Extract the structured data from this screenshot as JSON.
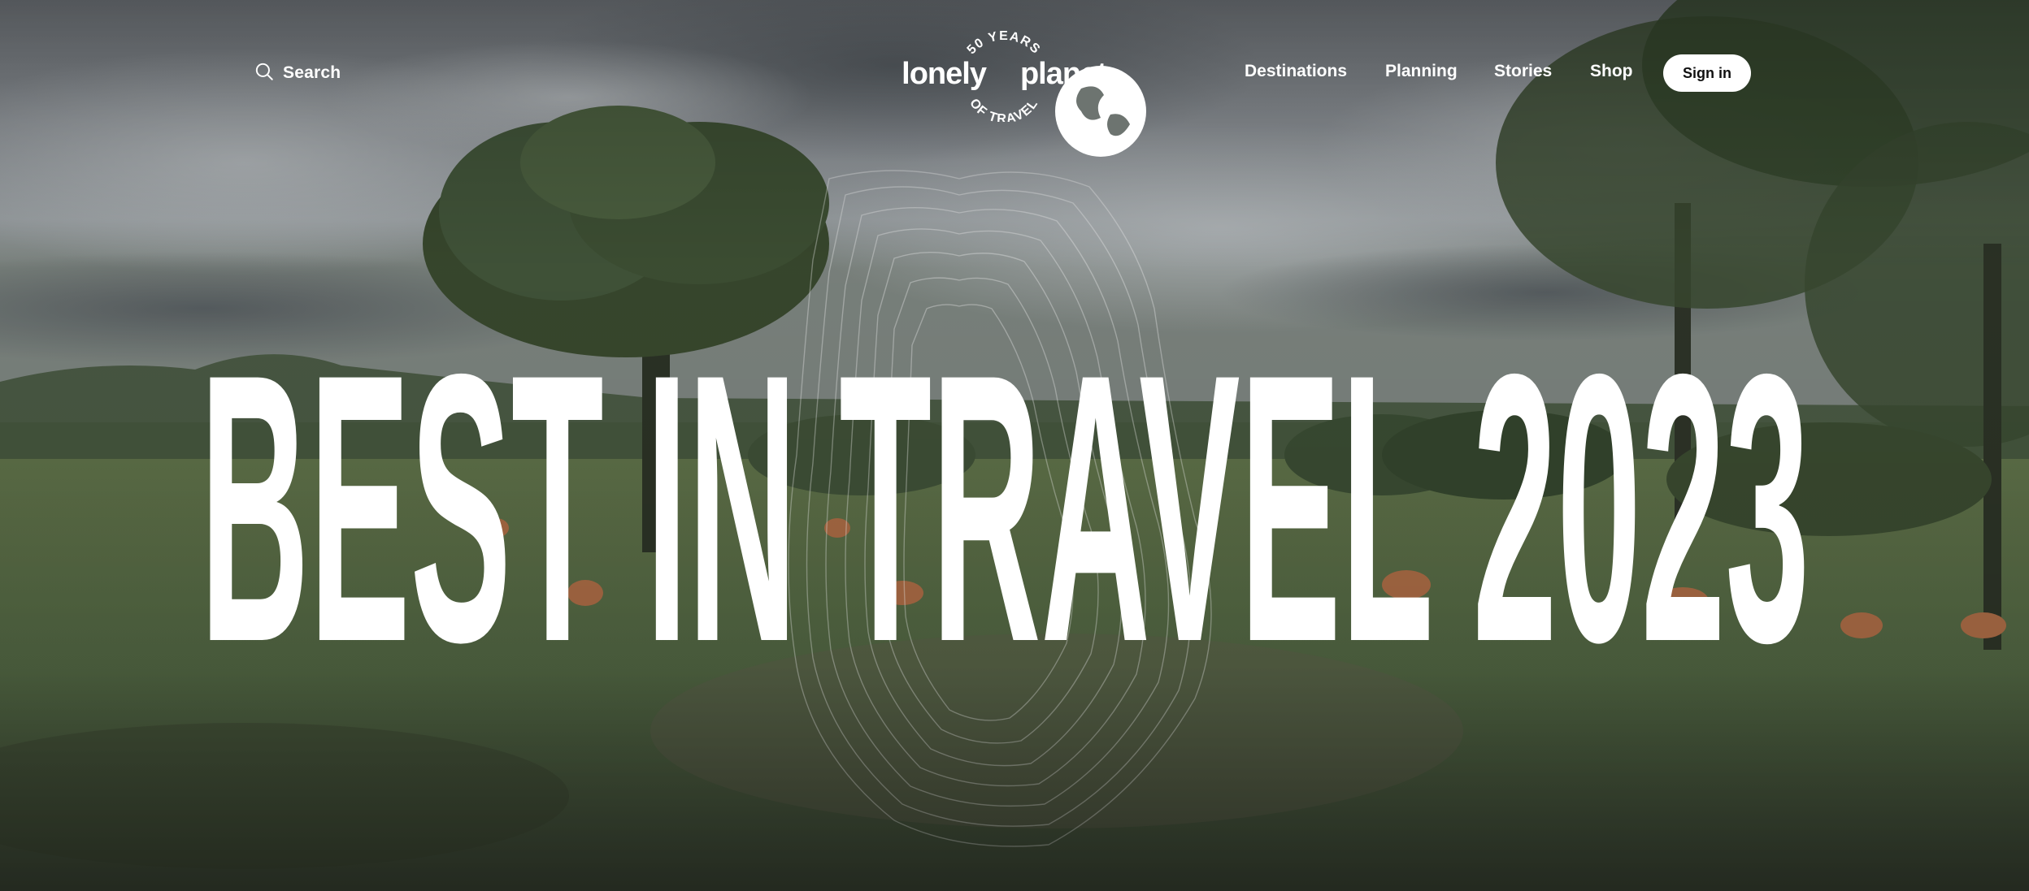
{
  "header": {
    "search_label": "Search",
    "search_icon": "search-icon",
    "logo": {
      "top_arc": "50 YEARS",
      "wordmark_left": "lonely",
      "wordmark_right": "planet",
      "bottom_arc": "OF TRAVEL"
    },
    "nav": [
      {
        "label": "Destinations"
      },
      {
        "label": "Planning"
      },
      {
        "label": "Stories"
      },
      {
        "label": "Shop"
      }
    ],
    "signin_label": "Sign in"
  },
  "hero": {
    "headline": "BEST IN TRAVEL 2023"
  },
  "colors": {
    "text": "#ffffff",
    "button_bg": "#ffffff",
    "button_text": "#111111"
  }
}
